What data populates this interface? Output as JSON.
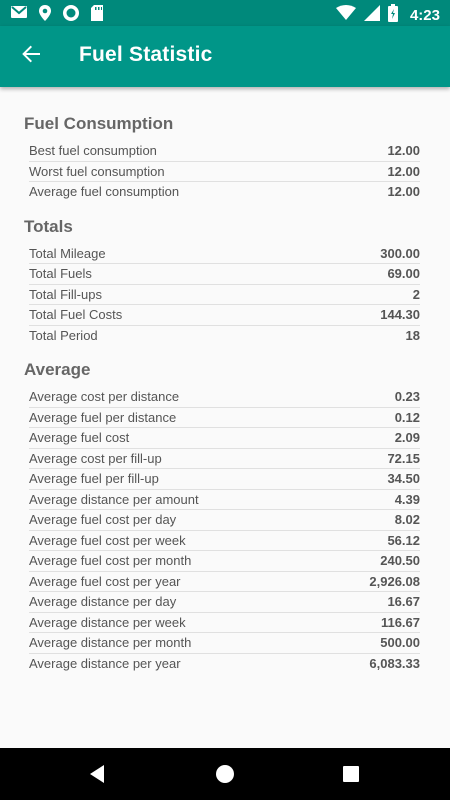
{
  "status_bar": {
    "time": "4:23",
    "icons": [
      "gmail-icon",
      "location-icon",
      "sync-icon",
      "sd-card-icon",
      "wifi-icon",
      "signal-icon",
      "battery-icon"
    ]
  },
  "toolbar": {
    "title": "Fuel Statistic",
    "back_icon": "arrow-back-icon"
  },
  "colors": {
    "status_bar": "#00897b",
    "toolbar": "#009688",
    "background": "#fafafa",
    "nav_bar": "#000000"
  },
  "sections": [
    {
      "title": "Fuel Consumption",
      "rows": [
        {
          "label": "Best fuel consumption",
          "value": "12.00"
        },
        {
          "label": "Worst fuel consumption",
          "value": "12.00"
        },
        {
          "label": "Average fuel consumption",
          "value": "12.00"
        }
      ]
    },
    {
      "title": "Totals",
      "rows": [
        {
          "label": "Total Mileage",
          "value": "300.00"
        },
        {
          "label": "Total Fuels",
          "value": "69.00"
        },
        {
          "label": "Total Fill-ups",
          "value": "2"
        },
        {
          "label": "Total Fuel Costs",
          "value": "144.30"
        },
        {
          "label": "Total Period",
          "value": "18"
        }
      ]
    },
    {
      "title": "Average",
      "rows": [
        {
          "label": "Average cost per distance",
          "value": "0.23"
        },
        {
          "label": "Average fuel per distance",
          "value": "0.12"
        },
        {
          "label": "Average fuel cost",
          "value": "2.09"
        },
        {
          "label": "Average cost per fill-up",
          "value": "72.15"
        },
        {
          "label": "Average fuel per fill-up",
          "value": "34.50"
        },
        {
          "label": "Average distance per amount",
          "value": "4.39"
        },
        {
          "label": "Average fuel cost per day",
          "value": "8.02"
        },
        {
          "label": "Average fuel cost per week",
          "value": "56.12"
        },
        {
          "label": "Average fuel cost per month",
          "value": "240.50"
        },
        {
          "label": "Average fuel cost per year",
          "value": "2,926.08"
        },
        {
          "label": "Average distance per day",
          "value": "16.67"
        },
        {
          "label": "Average distance per week",
          "value": "116.67"
        },
        {
          "label": "Average distance per month",
          "value": "500.00"
        },
        {
          "label": "Average distance per year",
          "value": "6,083.33"
        }
      ]
    }
  ]
}
